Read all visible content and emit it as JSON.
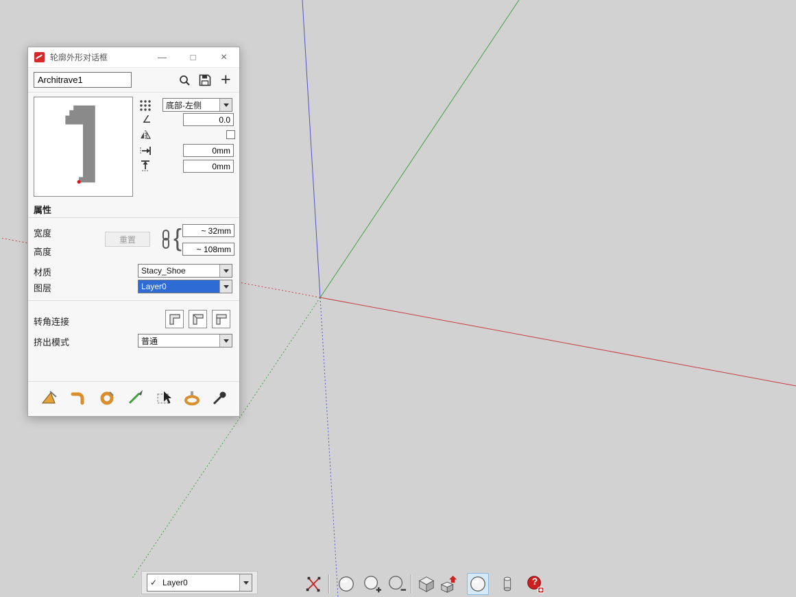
{
  "dialog": {
    "title": "轮廓外形对话框",
    "controls": {
      "minimize": "—",
      "maximize": "□",
      "close": "×"
    },
    "profile_name": "Architrave1",
    "add_label": "+",
    "anchor_value": "底部-左侧",
    "rotation_value": "0.0",
    "offset_x_value": "0mm",
    "offset_y_value": "0mm",
    "properties_header": "属性",
    "width_label": "宽度",
    "height_label": "高度",
    "reset_label": "重置",
    "link_brace": "{",
    "width_value": "~ 32mm",
    "height_value": "~ 108mm",
    "material_label": "材质",
    "material_value": "Stacy_Shoe",
    "layer_label": "图层",
    "layer_value": "Layer0",
    "corner_label": "转角连接",
    "extrude_label": "挤出模式",
    "extrude_value": "普通"
  },
  "statusbar": {
    "checkmark": "✓",
    "layer_value": "Layer0"
  },
  "icons": {
    "help_glyph": "?",
    "search": "magnifier",
    "save": "floppy-disk",
    "add": "plus",
    "anchor_grid": "9-dot-grid",
    "rotation": "angle",
    "mirror": "flip-horizontal",
    "offset_x": "move-horizontal",
    "offset_y": "move-vertical",
    "link": "chain",
    "dialog_toolbar": [
      "build-profile-tool",
      "profile-member-tool",
      "revolve-tool",
      "draw-path-tool",
      "select-members-tool",
      "stamp-tool",
      "eyedropper-tool"
    ],
    "bottom_toolbar": [
      "profile-edit-tool",
      "sphere-tool",
      "sphere-add-tool",
      "sphere-subtract-tool",
      "solid-tool",
      "solid-extrude-tool",
      "sphere-active-tool",
      "column-tool",
      "help-tool"
    ]
  },
  "colors": {
    "axis_red": "#c83c3c",
    "axis_green": "#3fa23f",
    "axis_blue": "#5252c8",
    "selection_blue": "#2e6bd4",
    "active_tool_bg": "#d5e9f7"
  }
}
